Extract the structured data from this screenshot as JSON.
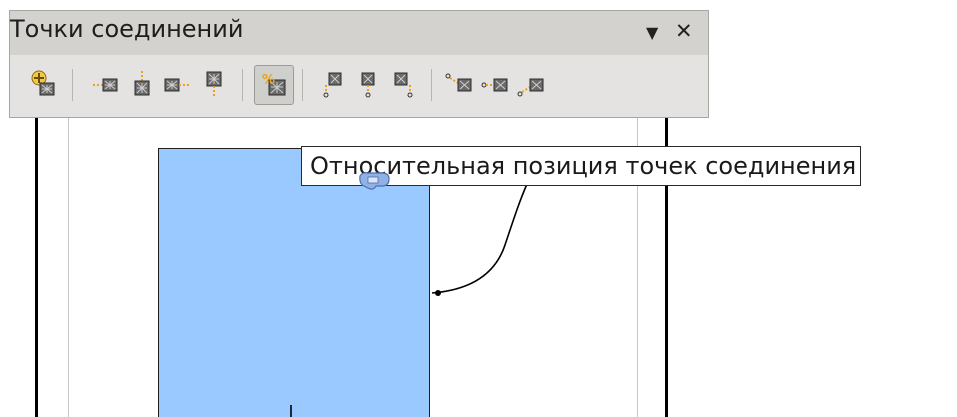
{
  "toolbar": {
    "title": "Точки соединений",
    "menu_icon": "triangle-down-icon",
    "close_icon": "close-icon",
    "items": [
      {
        "name": "insert-glue-point",
        "icon": "insert-glue-point-icon",
        "pressed": false
      },
      {
        "name": "exit-direction-left",
        "icon": "exit-left-icon",
        "pressed": false
      },
      {
        "name": "exit-direction-top",
        "icon": "exit-top-icon",
        "pressed": false
      },
      {
        "name": "exit-direction-right",
        "icon": "exit-right-icon",
        "pressed": false
      },
      {
        "name": "exit-direction-bottom",
        "icon": "exit-bottom-icon",
        "pressed": false
      },
      {
        "name": "glue-point-relative",
        "icon": "percent-icon",
        "pressed": true
      },
      {
        "name": "glue-point-horizontal-left",
        "icon": "align-left-icon",
        "pressed": false
      },
      {
        "name": "glue-point-horizontal-center",
        "icon": "align-center-icon",
        "pressed": false
      },
      {
        "name": "glue-point-horizontal-right",
        "icon": "align-right-icon",
        "pressed": false
      },
      {
        "name": "glue-point-vertical-top",
        "icon": "align-top-icon",
        "pressed": false
      },
      {
        "name": "glue-point-vertical-center",
        "icon": "align-middle-icon",
        "pressed": false
      },
      {
        "name": "glue-point-vertical-bottom",
        "icon": "align-bottom-icon",
        "pressed": false
      }
    ]
  },
  "tooltip": {
    "text": "Относительная позиция точек соединения"
  },
  "canvas": {
    "shape_fill": "#99c9ff",
    "shape_border": "#1f1f1f",
    "connector_color": "#000000"
  }
}
